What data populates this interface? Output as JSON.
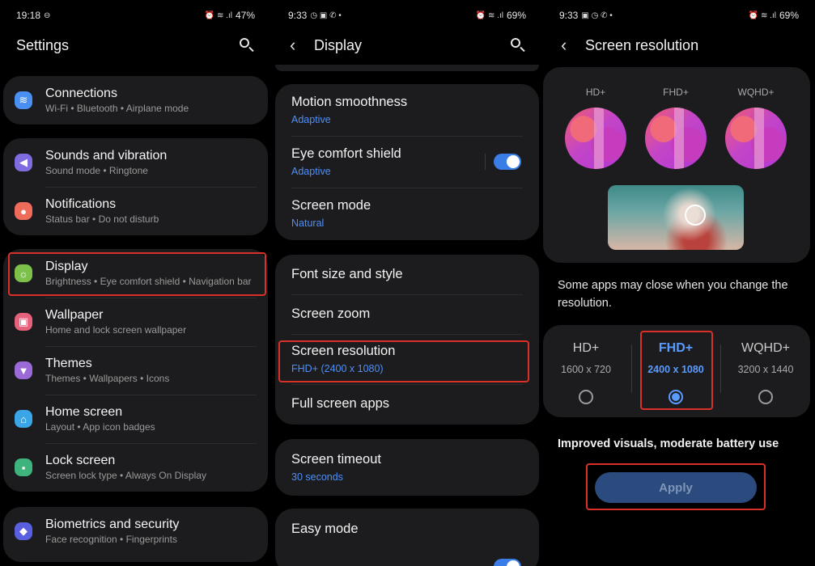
{
  "panel1": {
    "status": {
      "time": "19:18",
      "left_icon": "⊖",
      "right_icons": "⏰ ≋ .ıl",
      "battery": "47%"
    },
    "title": "Settings",
    "groups": [
      {
        "items": [
          {
            "title": "Connections",
            "subtitle": "Wi-Fi  •  Bluetooth  •  Airplane mode",
            "icon": "wifi-icon",
            "color": "#4a8ff2",
            "glyph": "≋"
          }
        ]
      },
      {
        "items": [
          {
            "title": "Sounds and vibration",
            "subtitle": "Sound mode  •  Ringtone",
            "icon": "speaker-icon",
            "color": "#7f6ce0",
            "glyph": "◀"
          },
          {
            "title": "Notifications",
            "subtitle": "Status bar  •  Do not disturb",
            "icon": "notification-icon",
            "color": "#ef6b5a",
            "glyph": "●"
          }
        ]
      },
      {
        "items": [
          {
            "title": "Display",
            "subtitle": "Brightness  •  Eye comfort shield  •  Navigation bar",
            "icon": "sun-icon",
            "color": "#7cc24a",
            "glyph": "☼"
          },
          {
            "title": "Wallpaper",
            "subtitle": "Home and lock screen wallpaper",
            "icon": "image-icon",
            "color": "#e7607c",
            "glyph": "▣"
          },
          {
            "title": "Themes",
            "subtitle": "Themes  •  Wallpapers  •  Icons",
            "icon": "brush-icon",
            "color": "#9b6ad6",
            "glyph": "▼"
          },
          {
            "title": "Home screen",
            "subtitle": "Layout  •  App icon badges",
            "icon": "home-icon",
            "color": "#3aa6e8",
            "glyph": "⌂"
          },
          {
            "title": "Lock screen",
            "subtitle": "Screen lock type  •  Always On Display",
            "icon": "lock-icon",
            "color": "#3fb37c",
            "glyph": "▪"
          }
        ]
      },
      {
        "items": [
          {
            "title": "Biometrics and security",
            "subtitle": "Face recognition  •  Fingerprints",
            "icon": "shield-icon",
            "color": "#5a5fe0",
            "glyph": "◆"
          }
        ]
      }
    ]
  },
  "panel2": {
    "status": {
      "time": "9:33",
      "left_icon": "◷ ▣ ✆ •",
      "right_icons": "⏰ ≋ .ıl",
      "battery": "69%"
    },
    "back": "‹",
    "title": "Display",
    "group1": [
      {
        "title": "Motion smoothness",
        "subtitle": "Adaptive"
      },
      {
        "title": "Eye comfort shield",
        "subtitle": "Adaptive"
      },
      {
        "title": "Screen mode",
        "subtitle": "Natural"
      }
    ],
    "group2": [
      {
        "title": "Font size and style"
      },
      {
        "title": "Screen zoom"
      },
      {
        "title": "Screen resolution",
        "subtitle": "FHD+ (2400 x 1080)"
      },
      {
        "title": "Full screen apps"
      }
    ],
    "group3": [
      {
        "title": "Screen timeout",
        "subtitle": "30 seconds"
      }
    ],
    "group4": [
      {
        "title": "Easy mode"
      }
    ]
  },
  "panel3": {
    "status": {
      "time": "9:33",
      "left_icon": "▣ ◷ ✆ •",
      "right_icons": "⏰ ≋ .ıl",
      "battery": "69%"
    },
    "back": "‹",
    "title": "Screen resolution",
    "preview_labels": [
      "HD+",
      "FHD+",
      "WQHD+"
    ],
    "note": "Some apps may close when you change the resolution.",
    "options": [
      {
        "name": "HD+",
        "size": "1600 x 720",
        "selected": false
      },
      {
        "name": "FHD+",
        "size": "2400 x 1080",
        "selected": true
      },
      {
        "name": "WQHD+",
        "size": "3200 x 1440",
        "selected": false
      }
    ],
    "improved": "Improved visuals, moderate battery use",
    "apply": "Apply"
  }
}
